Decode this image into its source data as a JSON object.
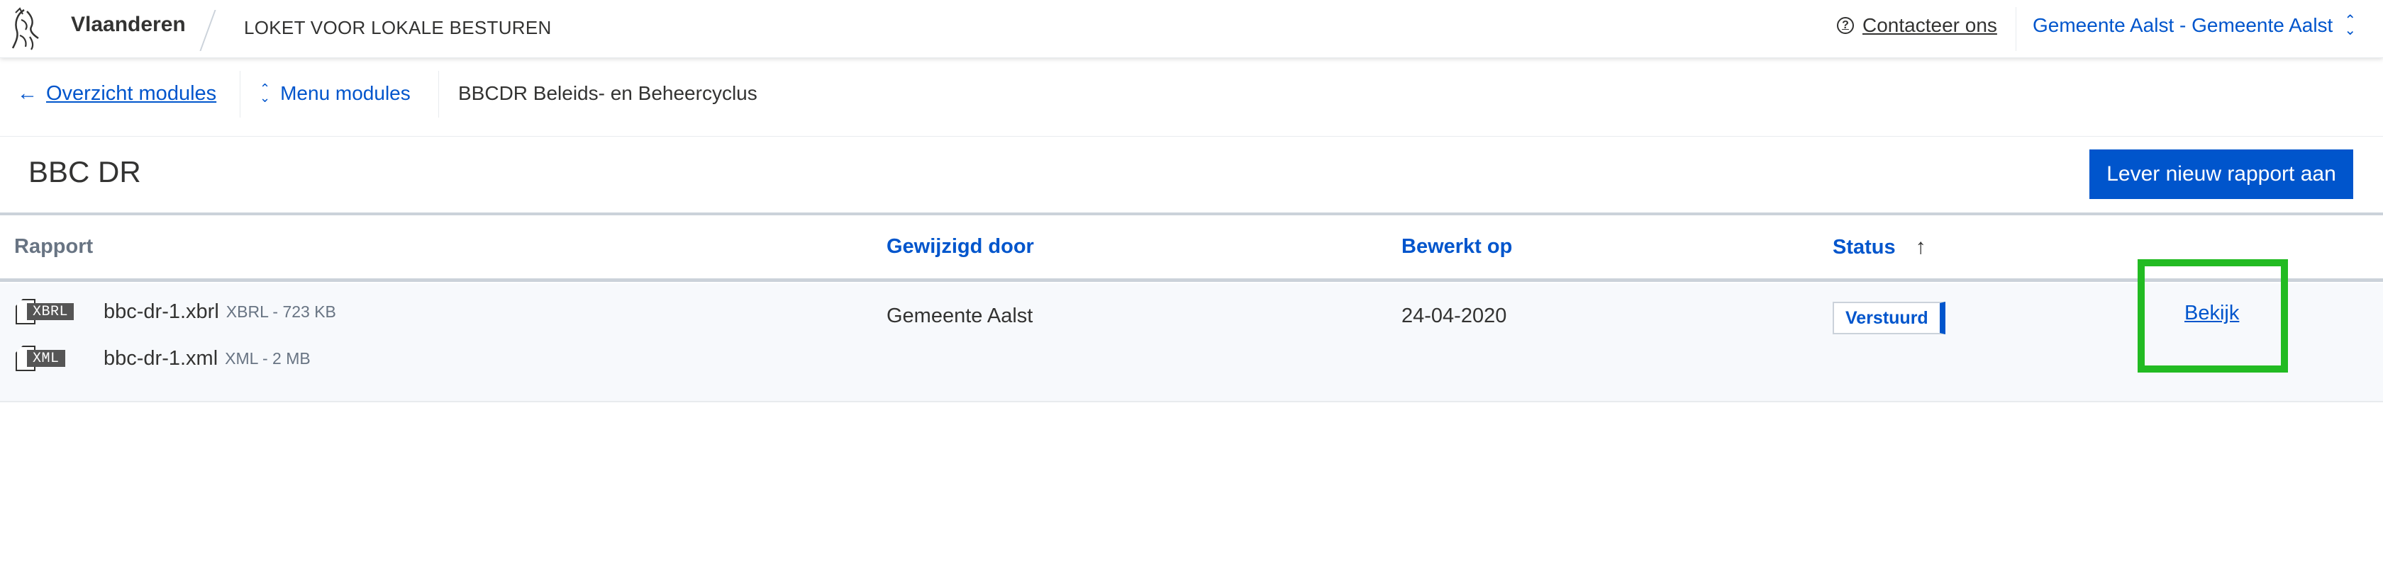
{
  "header": {
    "brand": "Vlaanderen",
    "host": "LOKET VOOR LOKALE BESTUREN",
    "contact": "Contacteer ons",
    "contact_icon": "question-circle-icon",
    "org_switcher": "Gemeente Aalst - Gemeente Aalst"
  },
  "subheader": {
    "back_label": "Overzicht modules",
    "menu_label": "Menu modules",
    "current": "BBCDR Beleids- en Beheercyclus"
  },
  "toolbar": {
    "title": "BBC DR",
    "primary_button": "Lever nieuw rapport aan"
  },
  "table": {
    "columns": [
      "Rapport",
      "Gewijzigd door",
      "Bewerkt op",
      "Status"
    ],
    "rows": [
      {
        "files": [
          {
            "type": "XBRL",
            "name": "bbc-dr-1.xbrl",
            "meta": "XBRL - 723 KB"
          },
          {
            "type": "XML",
            "name": "bbc-dr-1.xml",
            "meta": "XML - 2 MB"
          }
        ],
        "modified_by": "Gemeente Aalst",
        "edited_on": "24-04-2020",
        "status": "Verstuurd",
        "action": "Bekijk"
      }
    ]
  },
  "colors": {
    "accent": "#0055cc",
    "text": "#333332",
    "highlight": "#22bb22"
  }
}
